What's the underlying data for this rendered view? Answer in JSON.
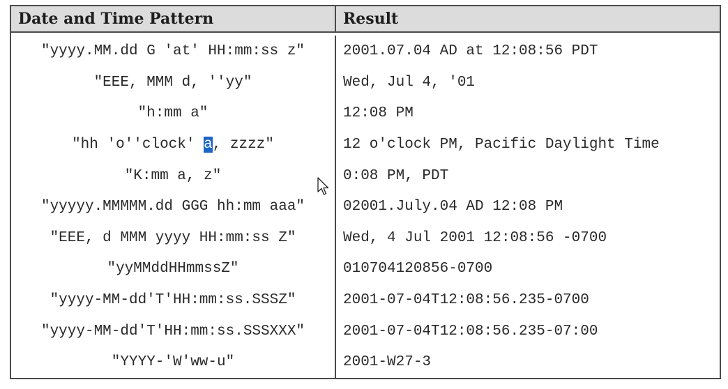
{
  "table": {
    "headers": {
      "pattern": "Date and Time Pattern",
      "result": "Result"
    },
    "rows": [
      {
        "pattern": "\"yyyy.MM.dd G 'at' HH:mm:ss z\"",
        "result": "2001.07.04 AD at 12:08:56 PDT"
      },
      {
        "pattern": "\"EEE, MMM d, ''yy\"",
        "result": "Wed, Jul 4, '01"
      },
      {
        "pattern": "\"h:mm a\"",
        "result": "12:08 PM"
      },
      {
        "pattern_before": "\"hh 'o''clock' ",
        "pattern_selected": "a",
        "pattern_after": ", zzzz\"",
        "result": "12 o'clock PM, Pacific Daylight Time"
      },
      {
        "pattern": "\"K:mm a, z\"",
        "result": "0:08 PM, PDT"
      },
      {
        "pattern": "\"yyyyy.MMMMM.dd GGG hh:mm aaa\"",
        "result": "02001.July.04 AD 12:08 PM"
      },
      {
        "pattern": "\"EEE, d MMM yyyy HH:mm:ss Z\"",
        "result": "Wed, 4 Jul 2001 12:08:56 -0700"
      },
      {
        "pattern": "\"yyMMddHHmmssZ\"",
        "result": "010704120856-0700"
      },
      {
        "pattern": "\"yyyy-MM-dd'T'HH:mm:ss.SSSZ\"",
        "result": "2001-07-04T12:08:56.235-0700"
      },
      {
        "pattern": "\"yyyy-MM-dd'T'HH:mm:ss.SSSXXX\"",
        "result": "2001-07-04T12:08:56.235-07:00"
      },
      {
        "pattern": "\"YYYY-'W'ww-u\"",
        "result": "2001-W27-3"
      }
    ]
  },
  "colors": {
    "header_bg": "#dcdcdc",
    "border": "#4a4a4a",
    "selection": "#1e64c8"
  },
  "icons": {
    "cursor": "mouse-pointer-icon"
  }
}
